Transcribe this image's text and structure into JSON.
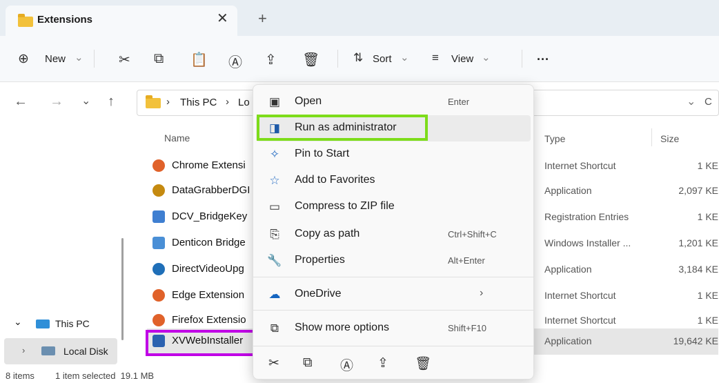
{
  "window": {
    "tab_title": "Extensions",
    "tab_close": "✕",
    "new_tab": "+"
  },
  "toolbar": {
    "new_label": "New",
    "sort_label": "Sort",
    "view_label": "View",
    "more_label": "···",
    "chevron": "⌄"
  },
  "address": {
    "path_part1": "This PC",
    "path_sep": "›",
    "path_part2": "Lo",
    "refresh": "C",
    "dropdown": "⌄"
  },
  "sidebar": {
    "this_pc": "This PC",
    "local_disk": "Local Disk"
  },
  "columns": {
    "name": "Name",
    "type": "Type",
    "size": "Size"
  },
  "files": [
    {
      "name": "Chrome Extensi",
      "type": "Internet Shortcut",
      "size": "1 KE",
      "icon": "shortcut-icon",
      "color": "#e0622a"
    },
    {
      "name": "DataGrabberDGI",
      "type": "Application",
      "size": "2,097 KE",
      "icon": "app-gear-icon",
      "color": "#c58a10"
    },
    {
      "name": "DCV_BridgeKey",
      "type": "Registration Entries",
      "size": "1 KE",
      "icon": "registry-icon",
      "color": "#3f7fd1"
    },
    {
      "name": "Denticon Bridge",
      "type": "Windows Installer ...",
      "size": "1,201 KE",
      "icon": "installer-icon",
      "color": "#4a8fd6"
    },
    {
      "name": "DirectVideoUpg",
      "type": "Application",
      "size": "3,184 KE",
      "icon": "app-gear-icon",
      "color": "#1f6fb8"
    },
    {
      "name": "Edge Extension",
      "type": "Internet Shortcut",
      "size": "1 KE",
      "icon": "shortcut-icon",
      "color": "#e0622a"
    },
    {
      "name": "Firefox Extensio",
      "type": "Internet Shortcut",
      "size": "1 KE",
      "icon": "shortcut-icon",
      "color": "#e0622a"
    },
    {
      "name": "XVWebInstaller",
      "type": "Application",
      "size": "19,642 KE",
      "icon": "installer-exe-icon",
      "color": "#2b62b0"
    }
  ],
  "status": {
    "items": "8 items",
    "selected": "1 item selected  19.1 MB"
  },
  "menu": {
    "open": {
      "label": "Open",
      "shortcut": "Enter"
    },
    "run_admin": {
      "label": "Run as administrator"
    },
    "pin_start": {
      "label": "Pin to Start"
    },
    "favorites": {
      "label": "Add to Favorites"
    },
    "zip": {
      "label": "Compress to ZIP file"
    },
    "copy_path": {
      "label": "Copy as path",
      "shortcut": "Ctrl+Shift+C"
    },
    "properties": {
      "label": "Properties",
      "shortcut": "Alt+Enter"
    },
    "onedrive": {
      "label": "OneDrive",
      "arrow": "›"
    },
    "more_options": {
      "label": "Show more options",
      "shortcut": "Shift+F10"
    }
  },
  "colors": {
    "run_highlight": "#7ddc1a",
    "file_highlight": "#c000e6",
    "folder": "#f2c13b"
  }
}
